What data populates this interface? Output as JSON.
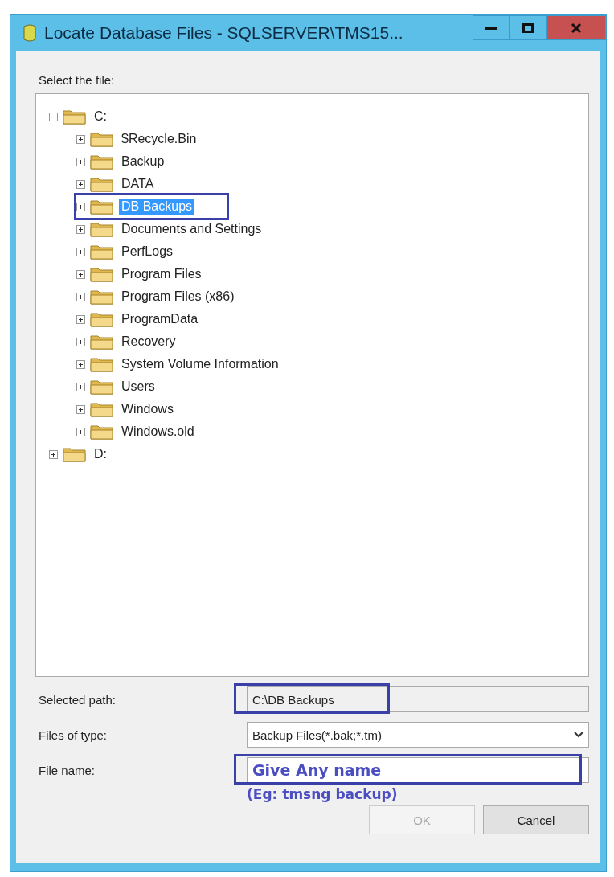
{
  "window": {
    "title": "Locate Database Files - SQLSERVER\\TMS15..."
  },
  "tree_label": "Select the file:",
  "tree": [
    {
      "label": "C:",
      "expanded": true,
      "selected": false,
      "highlighted": false,
      "children": [
        {
          "label": "$Recycle.Bin",
          "expanded": false,
          "selected": false,
          "highlighted": false
        },
        {
          "label": "Backup",
          "expanded": false,
          "selected": false,
          "highlighted": false
        },
        {
          "label": "DATA",
          "expanded": false,
          "selected": false,
          "highlighted": false
        },
        {
          "label": "DB Backups",
          "expanded": false,
          "selected": true,
          "highlighted": true
        },
        {
          "label": "Documents and Settings",
          "expanded": false,
          "selected": false,
          "highlighted": false
        },
        {
          "label": "PerfLogs",
          "expanded": false,
          "selected": false,
          "highlighted": false
        },
        {
          "label": "Program Files",
          "expanded": false,
          "selected": false,
          "highlighted": false
        },
        {
          "label": "Program Files (x86)",
          "expanded": false,
          "selected": false,
          "highlighted": false
        },
        {
          "label": "ProgramData",
          "expanded": false,
          "selected": false,
          "highlighted": false
        },
        {
          "label": "Recovery",
          "expanded": false,
          "selected": false,
          "highlighted": false
        },
        {
          "label": "System Volume Information",
          "expanded": false,
          "selected": false,
          "highlighted": false
        },
        {
          "label": "Users",
          "expanded": false,
          "selected": false,
          "highlighted": false
        },
        {
          "label": "Windows",
          "expanded": false,
          "selected": false,
          "highlighted": false
        },
        {
          "label": "Windows.old",
          "expanded": false,
          "selected": false,
          "highlighted": false
        }
      ]
    },
    {
      "label": "D:",
      "expanded": false,
      "selected": false,
      "highlighted": false
    }
  ],
  "fields": [
    {
      "kind": "readonly",
      "label": "Selected path:",
      "value": "C:\\DB Backups",
      "highlighted": true
    },
    {
      "kind": "dropdown",
      "label": "Files of type:",
      "value": "Backup Files(*.bak;*.tm)",
      "highlighted": false
    },
    {
      "kind": "text",
      "label": "File name:",
      "value": "Give Any name",
      "highlighted": true,
      "note": "(Eg: tmsng backup)"
    }
  ],
  "buttons": [
    {
      "label": "OK",
      "disabled": true
    },
    {
      "label": "Cancel",
      "disabled": false
    }
  ]
}
